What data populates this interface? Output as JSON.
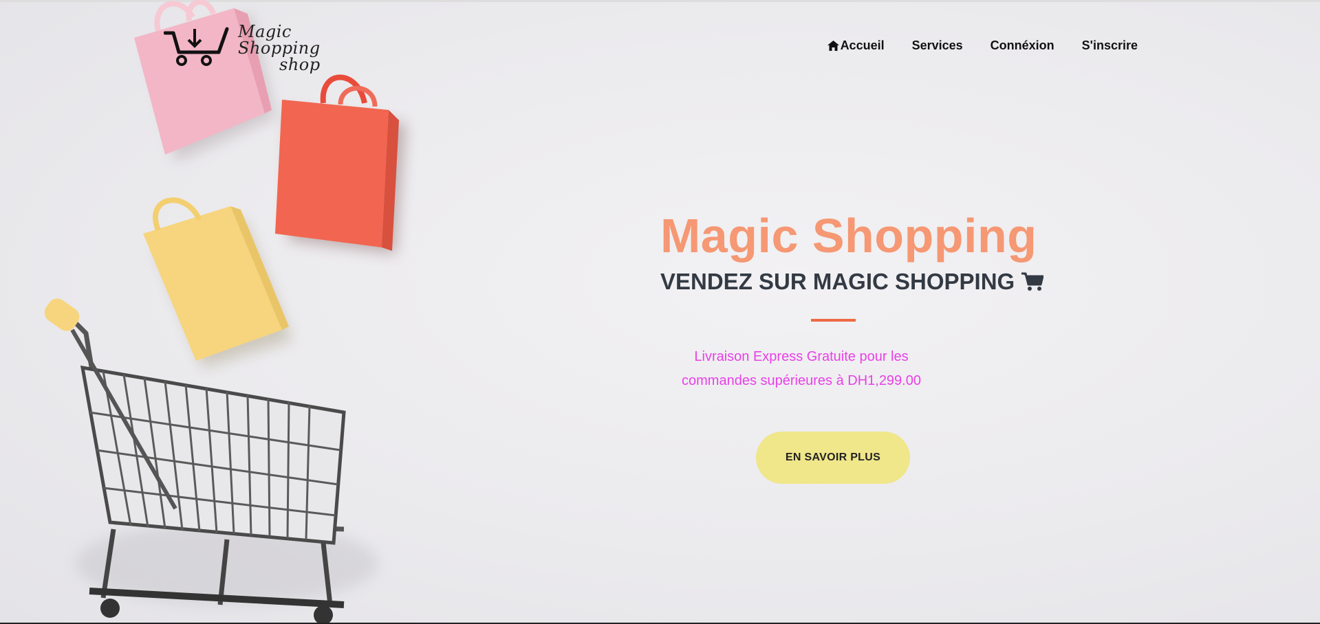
{
  "brand": {
    "logo_line1": "Magic Shopping",
    "logo_line2": "shop"
  },
  "nav": {
    "items": [
      {
        "label": "Accueil",
        "icon": "home-icon"
      },
      {
        "label": "Services"
      },
      {
        "label": "Connéxion"
      },
      {
        "label": "S'inscrire"
      }
    ]
  },
  "hero": {
    "title": "Magic Shopping",
    "subtitle": "VENDEZ SUR MAGIC SHOPPING",
    "subtitle_icon": "shopping-cart-icon",
    "description": "Livraison Express Gratuite pour les commandes supérieures à DH1,299.00",
    "cta_label": "EN SAVOIR PLUS"
  },
  "colors": {
    "title": "#f59873",
    "subtitle": "#333a44",
    "accent_rule": "#ef6a44",
    "description": "#e840e8",
    "cta_bg": "#f0e68a"
  }
}
